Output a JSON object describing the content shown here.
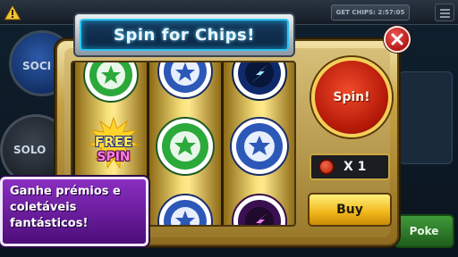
{
  "topbar": {
    "chips_button_label": "GET CHIPS: 2:57:05"
  },
  "lobby": {
    "social_label": "SOCI",
    "solo_label": "SOLO",
    "poke_label": "Poke"
  },
  "dialog": {
    "title": "Spin for Chips!",
    "free_label": "FREE",
    "spin_word": "SPIN",
    "spin_button_label": "Spin!",
    "multiplier_label": "X 1",
    "buy_label": "Buy",
    "promo_text": "Ganhe prémios e coletáveis fantásticos!"
  },
  "reels": [
    [
      "green-chip",
      "free-spin",
      "blue-chip"
    ],
    [
      "blue-chip",
      "green-chip",
      "blue-chip"
    ],
    [
      "blue-lightning-chip",
      "blue-chip",
      "purple-lightning-chip"
    ]
  ],
  "colors": {
    "accent_blue": "#2ec5f0",
    "gold": "#f3cf5a",
    "spin_red": "#d9290f",
    "promo_purple": "#6a1fa3"
  }
}
